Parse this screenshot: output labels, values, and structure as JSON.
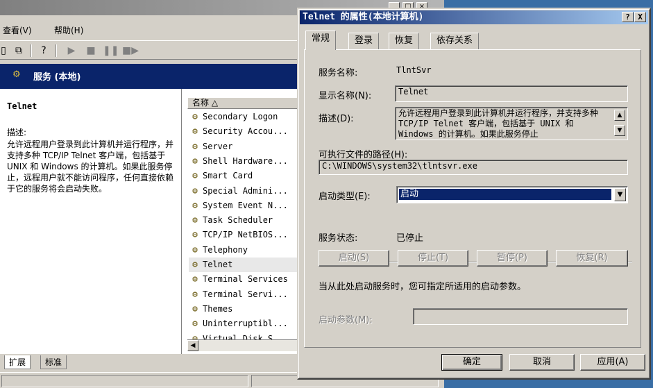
{
  "background_window": {
    "menu": [
      {
        "label": "查看(V)"
      },
      {
        "label": "帮助(H)"
      }
    ],
    "header_title": "服务 (本地)",
    "left_pane": {
      "service_name": "Telnet",
      "desc_label": "描述:",
      "desc_text": "允许远程用户登录到此计算机并运行程序，并支持多种 TCP/IP Telnet 客户端，包括基于 UNIX 和 Windows 的计算机。如果此服务停止，远程用户就不能访问程序，任何直接依赖于它的服务将会启动失败。"
    },
    "list": {
      "column_name": "名称 △",
      "items": [
        {
          "name": "Secondary Logon"
        },
        {
          "name": "Security Accou..."
        },
        {
          "name": "Server"
        },
        {
          "name": "Shell Hardware..."
        },
        {
          "name": "Smart Card"
        },
        {
          "name": "Special Admini..."
        },
        {
          "name": "System Event N..."
        },
        {
          "name": "Task Scheduler"
        },
        {
          "name": "TCP/IP NetBIOS..."
        },
        {
          "name": "Telephony"
        },
        {
          "name": "Telnet"
        },
        {
          "name": "Terminal Services"
        },
        {
          "name": "Terminal Servi..."
        },
        {
          "name": "Themes"
        },
        {
          "name": "Uninterruptibl..."
        },
        {
          "name": "Virtual Disk S..."
        }
      ]
    },
    "bottom_tabs": [
      "扩展",
      "标准"
    ]
  },
  "dialog": {
    "title": "Telnet 的属性(本地计算机)",
    "help_btn": "?",
    "close_btn": "X",
    "tabs": [
      "常规",
      "登录",
      "恢复",
      "依存关系"
    ],
    "service_name_label": "服务名称:",
    "service_name_value": "TlntSvr",
    "display_name_label": "显示名称(N):",
    "display_name_value": "Telnet",
    "description_label": "描述(D):",
    "description_value": "允许远程用户登录到此计算机并运行程序，并支持多种 TCP/IP Telnet 客户端，包括基于 UNIX 和 Windows 的计算机。如果此服务停止",
    "exe_path_label": "可执行文件的路径(H):",
    "exe_path_value": "C:\\WINDOWS\\system32\\tlntsvr.exe",
    "startup_type_label": "启动类型(E):",
    "startup_type_value": "启动",
    "status_label": "服务状态:",
    "status_value": "已停止",
    "btn_start": "启动(S)",
    "btn_stop": "停止(T)",
    "btn_pause": "暂停(P)",
    "btn_resume": "恢复(R)",
    "hint": "当从此处启动服务时，您可指定所适用的启动参数。",
    "params_label": "启动参数(M):",
    "params_value": "",
    "ok": "确定",
    "cancel": "取消",
    "apply": "应用(A)"
  }
}
